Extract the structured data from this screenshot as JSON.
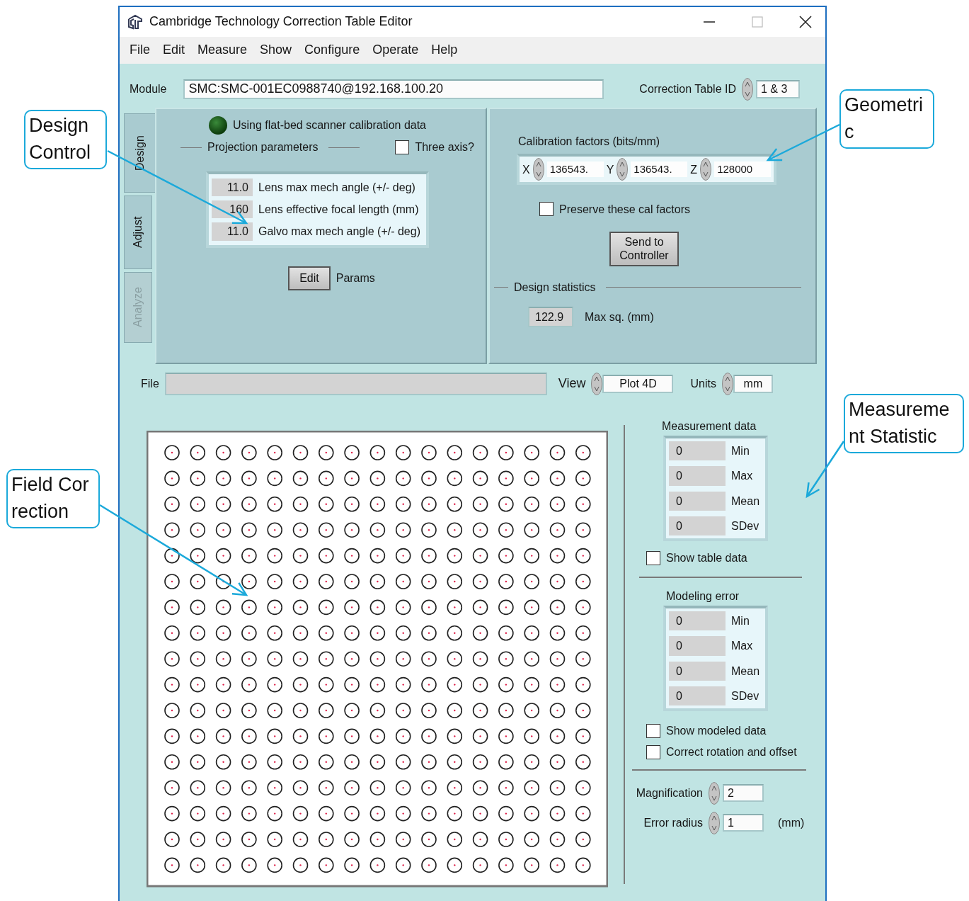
{
  "window": {
    "title": "Cambridge Technology Correction Table Editor"
  },
  "menu": [
    "File",
    "Edit",
    "Measure",
    "Show",
    "Configure",
    "Operate",
    "Help"
  ],
  "module": {
    "label": "Module",
    "value": "SMC:SMC-001EC0988740@192.168.100.20"
  },
  "correction_table_id": {
    "label": "Correction Table ID",
    "value": "1 & 3"
  },
  "tabs": [
    {
      "label": "Design",
      "selected": true,
      "disabled": false
    },
    {
      "label": "Adjust",
      "selected": false,
      "disabled": false
    },
    {
      "label": "Analyze",
      "selected": false,
      "disabled": true
    }
  ],
  "indicator": {
    "label": "Using flat-bed scanner calibration data",
    "on": true
  },
  "projection": {
    "title": "Projection parameters",
    "three_axis": {
      "label": "Three axis?",
      "checked": false
    },
    "params": [
      {
        "value": "11.0",
        "label": "Lens max mech angle (+/- deg)"
      },
      {
        "value": "160",
        "label": "Lens effective focal length (mm)"
      },
      {
        "value": "11.0",
        "label": "Galvo max mech angle (+/- deg)"
      }
    ],
    "edit_button": "Edit",
    "edit_label": "Params"
  },
  "calibration": {
    "title": "Calibration factors (bits/mm)",
    "factors": [
      {
        "axis": "X",
        "value": "136543."
      },
      {
        "axis": "Y",
        "value": "136543."
      },
      {
        "axis": "Z",
        "value": "128000"
      }
    ],
    "preserve": {
      "label": "Preserve these cal factors",
      "checked": false
    },
    "send_button": "Send to Controller"
  },
  "design_statistics": {
    "title": "Design statistics",
    "value": "122.9",
    "label": "Max sq. (mm)"
  },
  "file": {
    "label": "File"
  },
  "view": {
    "label": "View",
    "value": "Plot 4D"
  },
  "units": {
    "label": "Units",
    "value": "mm"
  },
  "measurement_data": {
    "title": "Measurement data",
    "stats": [
      {
        "value": "0",
        "label": "Min"
      },
      {
        "value": "0",
        "label": "Max"
      },
      {
        "value": "0",
        "label": "Mean"
      },
      {
        "value": "0",
        "label": "SDev"
      }
    ],
    "show_table_data": {
      "label": "Show table data",
      "checked": false
    }
  },
  "modeling_error": {
    "title": "Modeling error",
    "stats": [
      {
        "value": "0",
        "label": "Min"
      },
      {
        "value": "0",
        "label": "Max"
      },
      {
        "value": "0",
        "label": "Mean"
      },
      {
        "value": "0",
        "label": "SDev"
      }
    ],
    "options": [
      {
        "label": "Show modeled data",
        "checked": false
      },
      {
        "label": "Correct rotation and offset",
        "checked": false
      }
    ]
  },
  "magnification": {
    "label": "Magnification",
    "value": "2"
  },
  "error_radius": {
    "label": "Error radius",
    "value": "1",
    "unit": "(mm)"
  },
  "callouts": [
    {
      "text": "Design Control"
    },
    {
      "text": "Geometric"
    },
    {
      "text": "Measurement Statistic"
    },
    {
      "text": "Field Correction"
    }
  ]
}
